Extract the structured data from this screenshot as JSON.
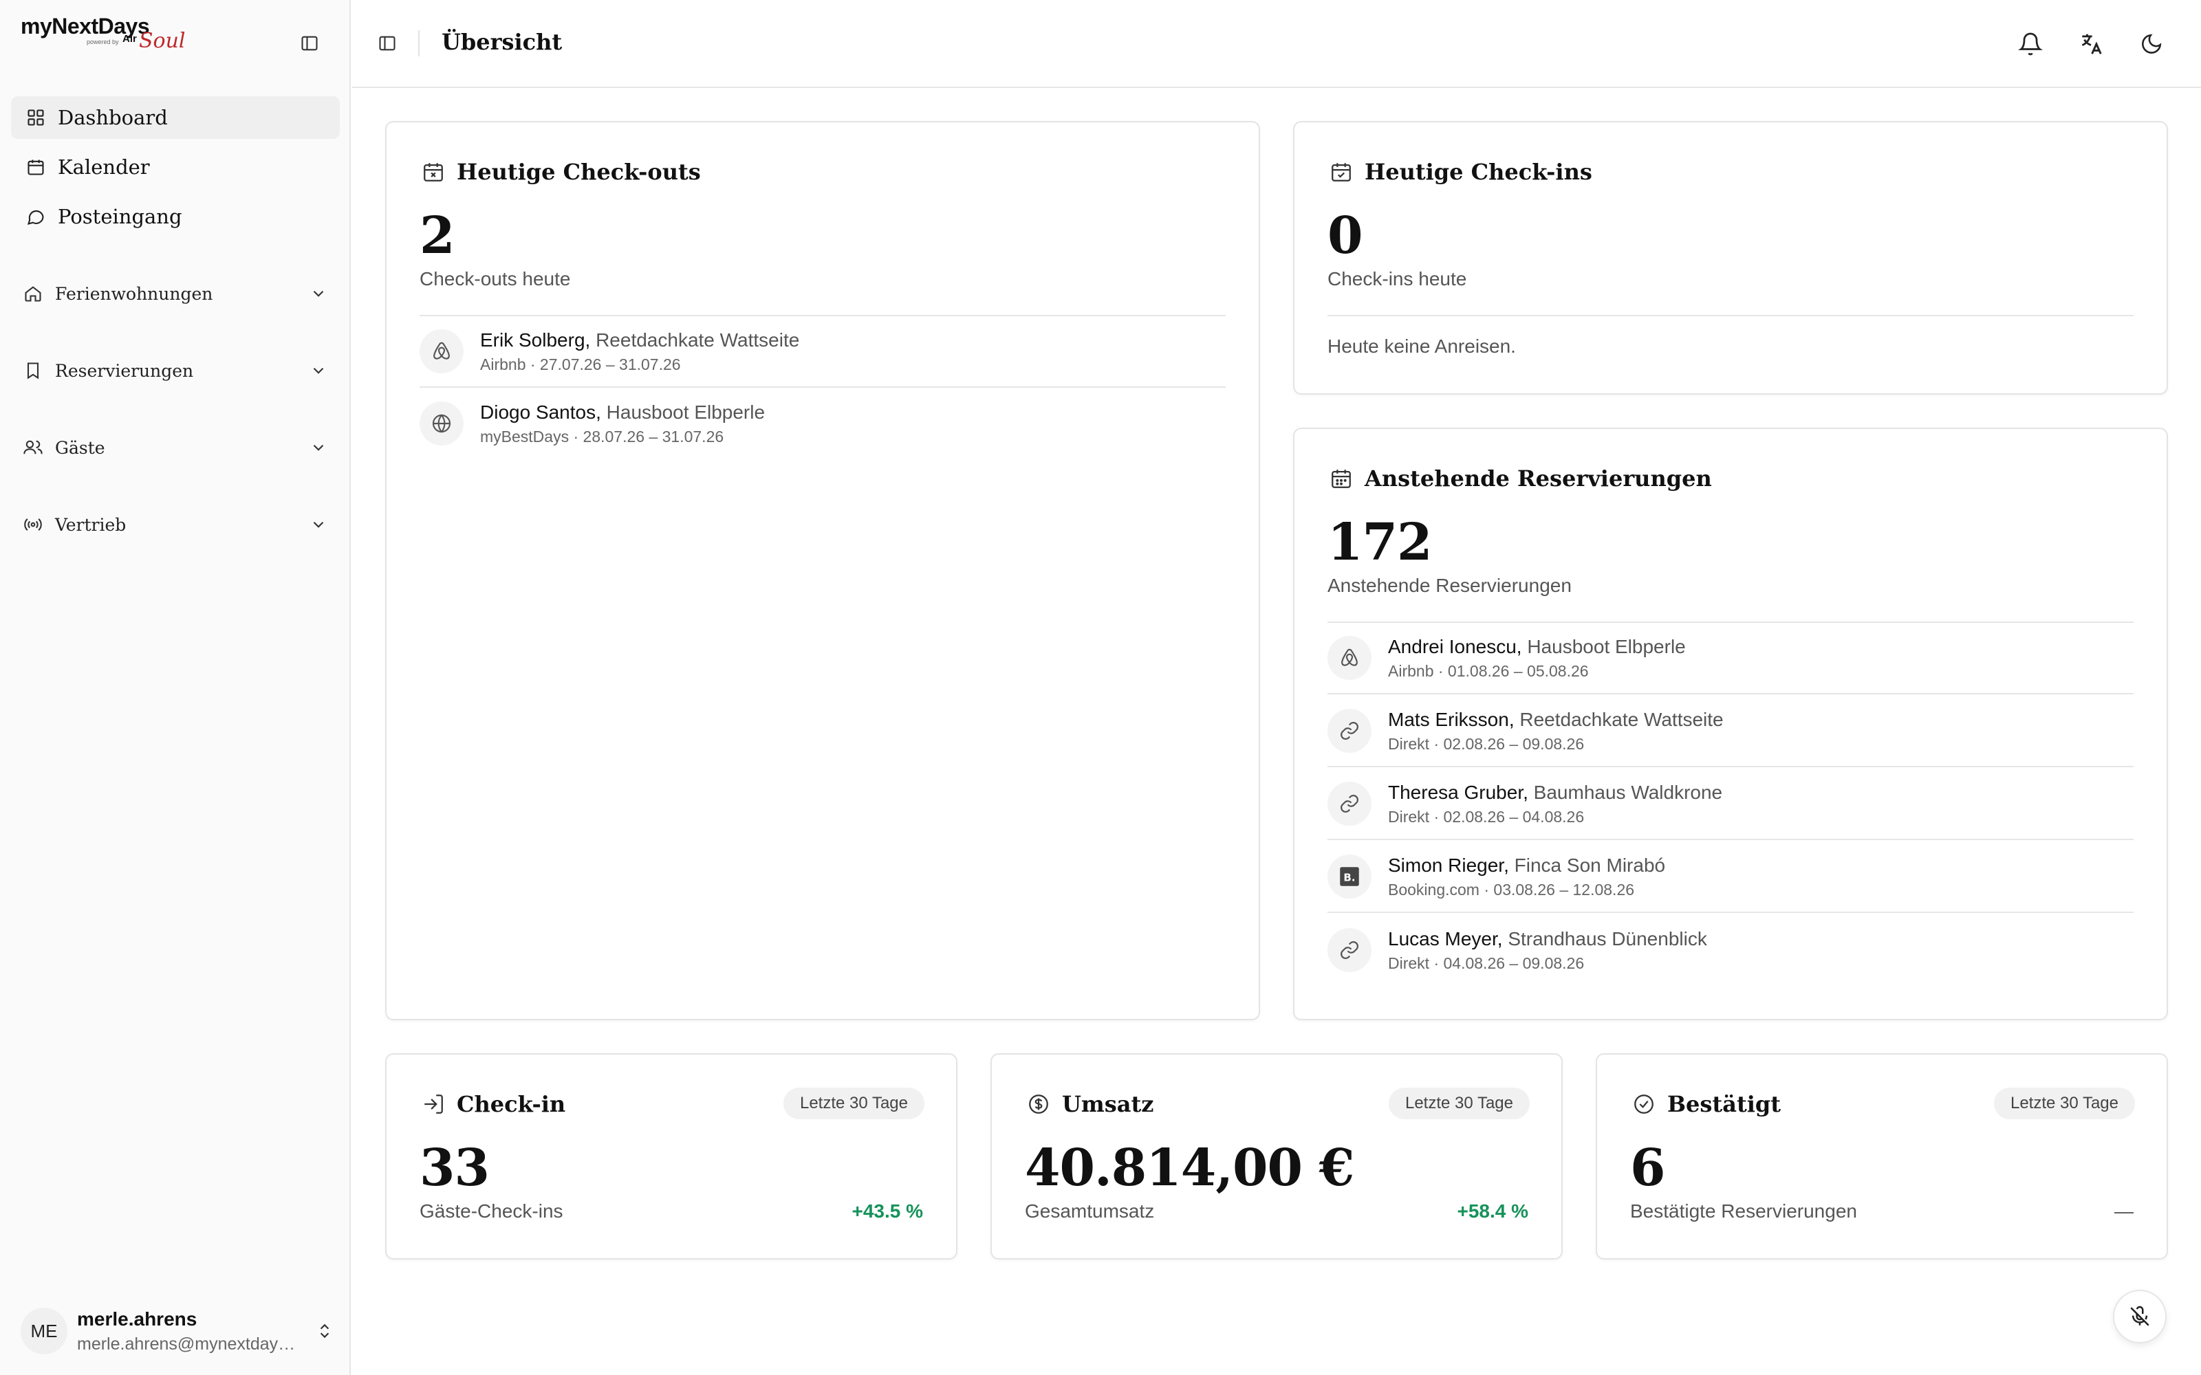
{
  "brand": {
    "name": "myNextDays",
    "powered_by": "powered by",
    "logo_text": "Air",
    "logo_script": "Soul"
  },
  "sidebar": {
    "nav": [
      {
        "label": "Dashboard",
        "icon": "grid-icon",
        "active": true
      },
      {
        "label": "Kalender",
        "icon": "calendar-icon"
      },
      {
        "label": "Posteingang",
        "icon": "chat-bubble-icon"
      }
    ],
    "groups": [
      {
        "label": "Ferienwohnungen",
        "icon": "house-icon"
      },
      {
        "label": "Reservierungen",
        "icon": "bookmark-icon"
      },
      {
        "label": "Gäste",
        "icon": "users-icon"
      },
      {
        "label": "Vertrieb",
        "icon": "broadcast-icon"
      }
    ],
    "user": {
      "initials": "ME",
      "name": "merle.ahrens",
      "email": "merle.ahrens@mynextdays.de"
    }
  },
  "header": {
    "title": "Übersicht",
    "icons": [
      "bell-icon",
      "translate-icon",
      "moon-icon"
    ]
  },
  "checkouts": {
    "title": "Heutige Check-outs",
    "count": "2",
    "subtitle": "Check-outs heute",
    "rows": [
      {
        "guest": "Erik Solberg",
        "property": "Reetdachkate Wattseite",
        "meta": "Airbnb · 27.07.26 – 31.07.26",
        "channel": "airbnb-icon"
      },
      {
        "guest": "Diogo Santos",
        "property": "Hausboot Elbperle",
        "meta": "myBestDays · 28.07.26 – 31.07.26",
        "channel": "globe-icon"
      }
    ]
  },
  "checkins": {
    "title": "Heutige Check-ins",
    "count": "0",
    "subtitle": "Check-ins heute",
    "empty": "Heute keine Anreisen."
  },
  "upcoming": {
    "title": "Anstehende Reservierungen",
    "count": "172",
    "subtitle": "Anstehende Reservierungen",
    "rows": [
      {
        "guest": "Andrei Ionescu",
        "property": "Hausboot Elbperle",
        "meta": "Airbnb · 01.08.26 – 05.08.26",
        "channel": "airbnb-icon"
      },
      {
        "guest": "Mats Eriksson",
        "property": "Reetdachkate Wattseite",
        "meta": "Direkt · 02.08.26 – 09.08.26",
        "channel": "link-icon"
      },
      {
        "guest": "Theresa Gruber",
        "property": "Baumhaus Waldkrone",
        "meta": "Direkt · 02.08.26 – 04.08.26",
        "channel": "link-icon"
      },
      {
        "guest": "Simon Rieger",
        "property": "Finca Son Mirabó",
        "meta": "Booking.com · 03.08.26 – 12.08.26",
        "channel": "booking-icon"
      },
      {
        "guest": "Lucas Meyer",
        "property": "Strandhaus Dünenblick",
        "meta": "Direkt · 04.08.26 – 09.08.26",
        "channel": "link-icon"
      }
    ]
  },
  "stats": [
    {
      "title": "Check-in",
      "badge": "Letzte 30 Tage",
      "value": "33",
      "label": "Gäste-Check-ins",
      "delta": "+43.5 %",
      "icon": "login-icon"
    },
    {
      "title": "Umsatz",
      "badge": "Letzte 30 Tage",
      "value": "40.814,00 €",
      "label": "Gesamtumsatz",
      "delta": "+58.4 %",
      "icon": "dollar-circle-icon"
    },
    {
      "title": "Bestätigt",
      "badge": "Letzte 30 Tage",
      "value": "6",
      "label": "Bestätigte Reservierungen",
      "delta": "—",
      "icon": "check-circle-icon"
    }
  ],
  "colors": {
    "positive": "#16925a",
    "neutral": "#555555",
    "booking_badge": "#444444"
  }
}
